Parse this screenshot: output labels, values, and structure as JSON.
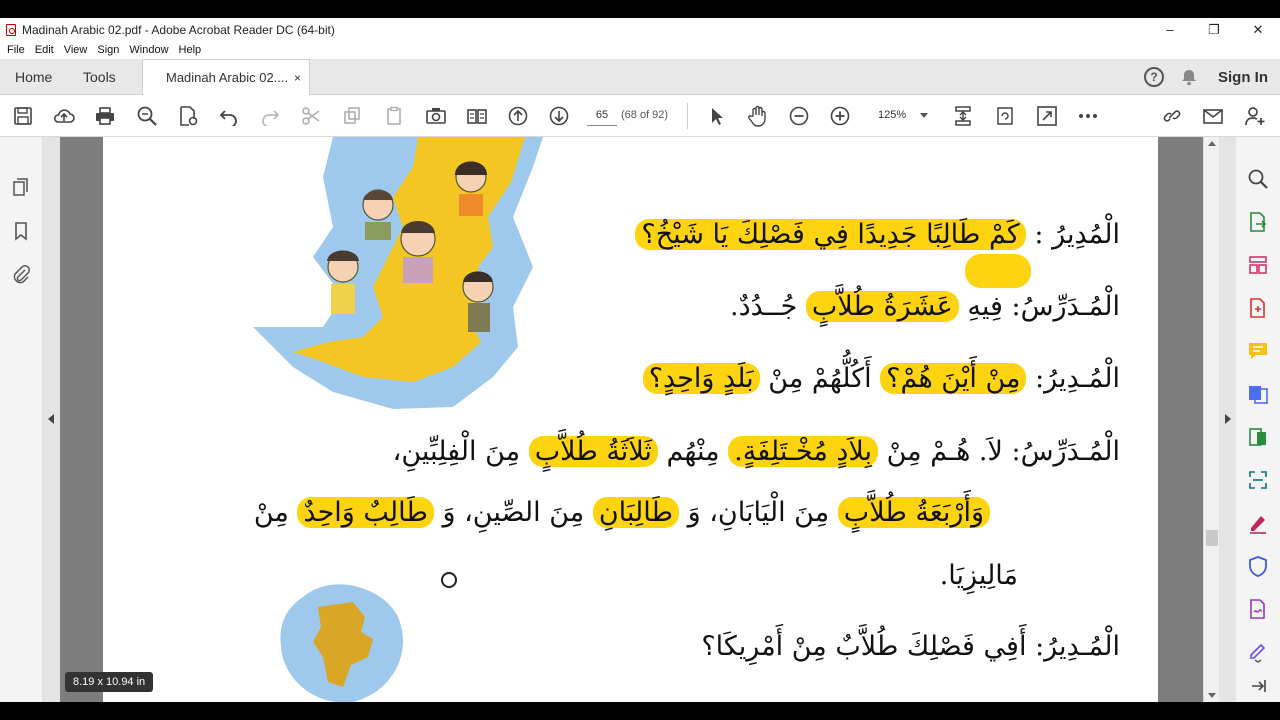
{
  "window": {
    "title": "Madinah Arabic 02.pdf - Adobe Acrobat Reader DC (64-bit)",
    "controls": [
      "–",
      "❐",
      "✕"
    ]
  },
  "menu": [
    "File",
    "Edit",
    "View",
    "Sign",
    "Window",
    "Help"
  ],
  "tabs": {
    "home": "Home",
    "tools": "Tools",
    "document": "Madinah Arabic 02....",
    "close": "×",
    "help": "?",
    "sign_in": "Sign In"
  },
  "toolbar": {
    "page_number": "65",
    "page_count": "(68 of 92)",
    "zoom": "125%"
  },
  "document": {
    "lines": [
      {
        "speaker": "الْمُدِيرُ :",
        "text": "كَمْ طَالِبًا جَدِيدًا فِي فَصْلِكَ يَا شَيْخُ؟"
      },
      {
        "speaker": "الْمُـدَرِّسُ:",
        "pre": "فِيهِ",
        "text": "عَشَرَةُ طُلاَّبٍ",
        "post": "جُــدُدٌ."
      },
      {
        "speaker": "الْمُـدِيرُ:",
        "text": "مِنْ أَيْنَ هُمْ؟",
        "mid": "أَكُلُّهُمْ مِنْ",
        "text2": "بَلَدٍ وَاحِدٍ؟"
      },
      {
        "speaker": "الْمُـدَرِّسُ:",
        "pre": "لاَ. هُـمْ مِنْ",
        "text": "بِلاَدٍ مُخْـتَلِفَةٍ.",
        "mid": "مِنْهُم",
        "text2": "ثَلاَثَةُ طُلاَّبٍ",
        "post": "مِنَ الْفِلِبِّينِ،"
      },
      {
        "text": "وَأَرْبَعَةُ طُلاَّبٍ",
        "mid": "مِنَ الْيَابَانِ، وَ",
        "text2": "طَالِبَانِ",
        "mid2": "مِنَ الصِّينِ، وَ",
        "text3": "طَالِبٌ وَاحِدٌ",
        "post": "مِنْ"
      },
      {
        "text": "مَالِيزِيَا."
      },
      {
        "speaker": "الْمُـدِيرُ:",
        "text": "أَفِي فَصْلِكَ طُلاَّبٌ مِنْ أَمْرِيكَا؟"
      }
    ],
    "page_size": "8.19 x 10.94 in"
  },
  "colors": {
    "highlight": "#fdd40f",
    "map_water": "#7fb6e6",
    "map_land": "#f3c623"
  }
}
